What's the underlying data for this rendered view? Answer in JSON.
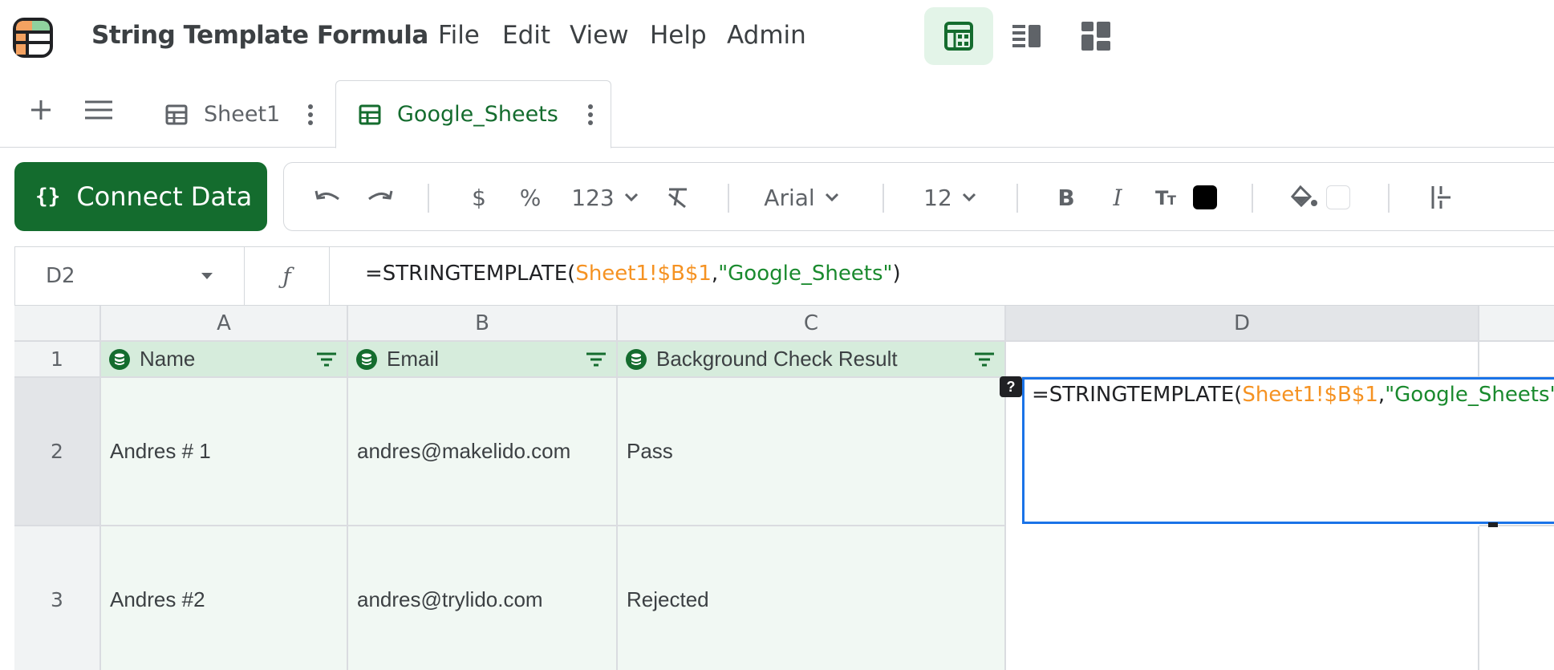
{
  "app": {
    "title": "String Template Formula"
  },
  "menu": [
    "File",
    "Edit",
    "View",
    "Help",
    "Admin"
  ],
  "view_buttons": [
    "spreadsheet-view-icon",
    "form-view-icon",
    "dashboard-view-icon"
  ],
  "tabs": [
    {
      "label": "Sheet1",
      "active": false
    },
    {
      "label": "Google_Sheets",
      "active": true
    }
  ],
  "toolbar": {
    "connect_label": "Connect Data",
    "braces": "{}",
    "currency": "$",
    "percent": "%",
    "number_format": "123",
    "font": "Arial",
    "font_size": "12",
    "bold": "B",
    "italic": "I",
    "text_color": "#000000",
    "fill_color": "#ffffff"
  },
  "formula_bar": {
    "cell_ref": "D2",
    "fx": "ƒ",
    "formula_prefix": "=STRINGTEMPLATE(",
    "formula_ref": "Sheet1!$B$1",
    "formula_sep": ",",
    "formula_str": "\"Google_Sheets\"",
    "formula_suffix": ")"
  },
  "grid": {
    "columns": [
      "A",
      "B",
      "C",
      "D"
    ],
    "rows": [
      "1",
      "2",
      "3"
    ],
    "headers": [
      "Name",
      "Email",
      "Background Check Result"
    ],
    "data": [
      [
        "Andres # 1",
        "andres@makelido.com",
        "Pass"
      ],
      [
        "Andres #2",
        "andres@trylido.com",
        "Rejected"
      ]
    ],
    "help_badge": "?"
  },
  "colors": {
    "brand_green": "#146c2e",
    "formula_ref": "#f59222",
    "formula_string": "#1a8a2e",
    "selection": "#1a73e8"
  }
}
